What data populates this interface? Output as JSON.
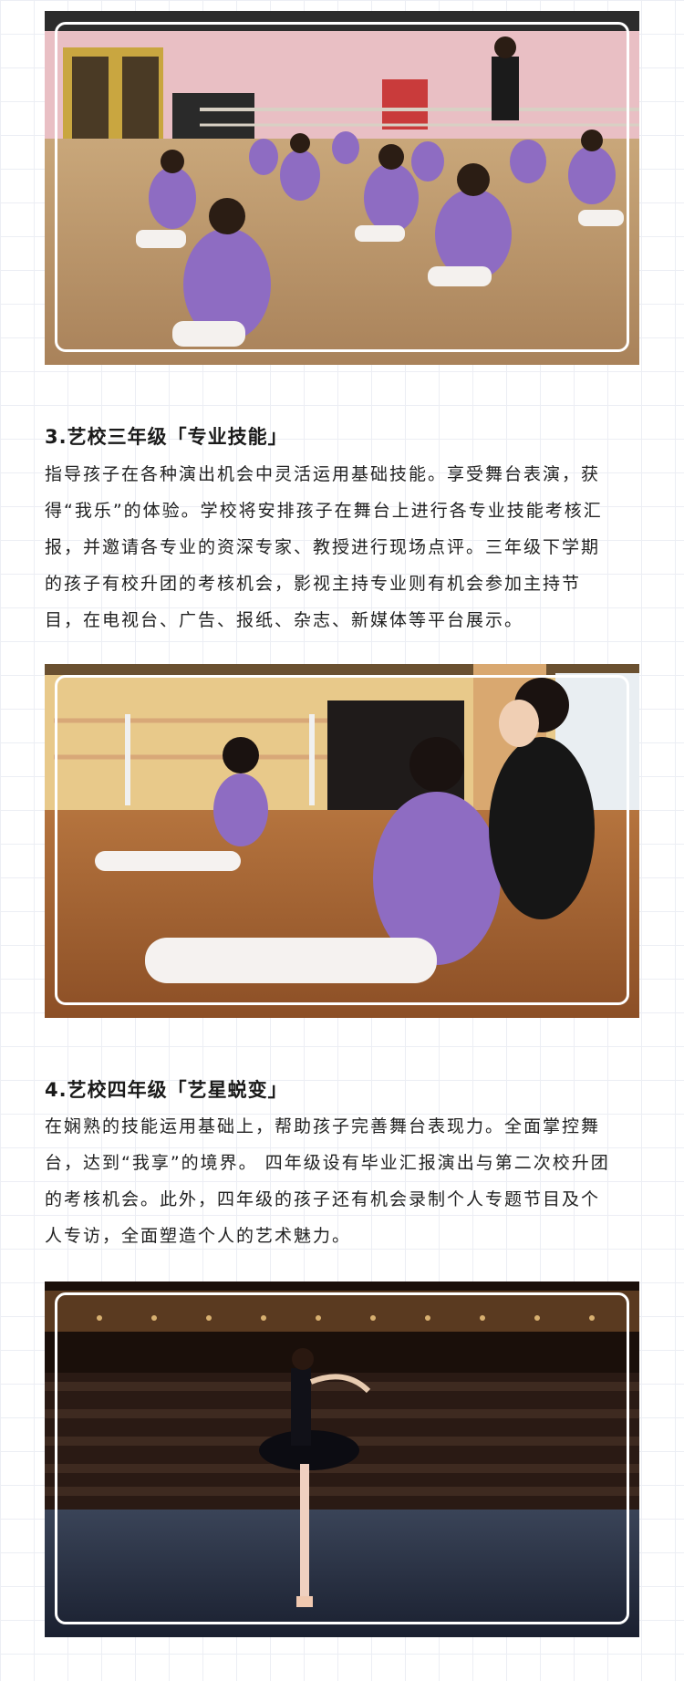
{
  "sections": [
    {
      "title": "3.艺校三年级「专业技能」",
      "lines": [
        "指导孩子在各种演出机会中灵活运用基础技能。享受舞台表演，获",
        "得“我乐”的体验。学校将安排孩子在舞台上进行各专业技能考核汇",
        "报，并邀请各专业的资深专家、教授进行现场点评。三年级下学期",
        "的孩子有校升团的考核机会，影视主持专业则有机会参加主持节",
        "目，在电视台、广告、报纸、杂志、新媒体等平台展示。"
      ]
    },
    {
      "title": "4.艺校四年级「艺星蜕变」",
      "lines": [
        "在娴熟的技能运用基础上，帮助孩子完善舞台表现力。全面掌控舞",
        "台，达到“我享”的境界。 四年级设有毕业汇报演出与第二次校升团",
        "的考核机会。此外，四年级的孩子还有机会录制个人专题节目及个",
        "人专访，全面塑造个人的艺术魅力。"
      ]
    }
  ],
  "colors": {
    "accent_purple": "#8e6cc2",
    "frame": "#ffffff",
    "text": "#222222"
  }
}
